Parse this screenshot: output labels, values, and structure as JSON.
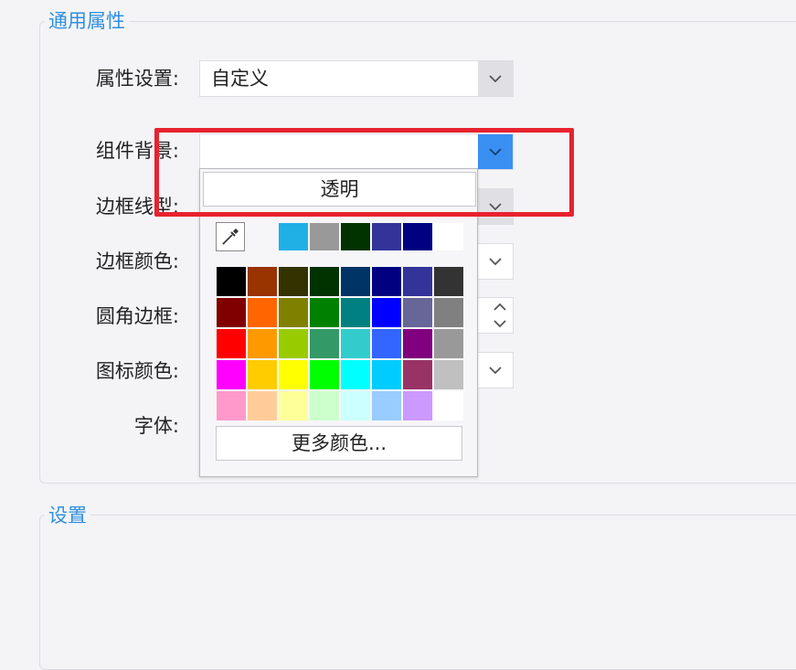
{
  "general_group": {
    "title": "通用属性"
  },
  "settings_group": {
    "title": "设置"
  },
  "fields": {
    "attribute_setting": {
      "label": "属性设置:",
      "value": "自定义"
    },
    "component_background": {
      "label": "组件背景:",
      "value": ""
    },
    "border_line_type": {
      "label": "边框线型:"
    },
    "border_color": {
      "label": "边框颜色:"
    },
    "rounded_border": {
      "label": "圆角边框:"
    },
    "icon_color": {
      "label": "图标颜色:"
    },
    "font": {
      "label": "字体:"
    }
  },
  "color_popup": {
    "transparent_label": "透明",
    "more_colors_label": "更多颜色...",
    "recent_colors": [
      "#1fb0e6",
      "#999999",
      "#003300",
      "#333399",
      "#000080",
      "#ffffff"
    ],
    "palette": [
      [
        "#000000",
        "#993300",
        "#333300",
        "#003300",
        "#003366",
        "#000080",
        "#333399",
        "#333333"
      ],
      [
        "#800000",
        "#ff6600",
        "#808000",
        "#008000",
        "#008080",
        "#0000ff",
        "#666699",
        "#808080"
      ],
      [
        "#ff0000",
        "#ff9900",
        "#99cc00",
        "#339966",
        "#33cccc",
        "#3366ff",
        "#800080",
        "#999999"
      ],
      [
        "#ff00ff",
        "#ffcc00",
        "#ffff00",
        "#00ff00",
        "#00ffff",
        "#00ccff",
        "#993366",
        "#c0c0c0"
      ],
      [
        "#ff99cc",
        "#ffcc99",
        "#ffff99",
        "#ccffcc",
        "#ccffff",
        "#99ccff",
        "#cc99ff",
        "#ffffff"
      ]
    ]
  },
  "colors": {
    "accent": "#3a8ff2",
    "highlight": "#e8222e",
    "legend": "#2f8fdf"
  }
}
